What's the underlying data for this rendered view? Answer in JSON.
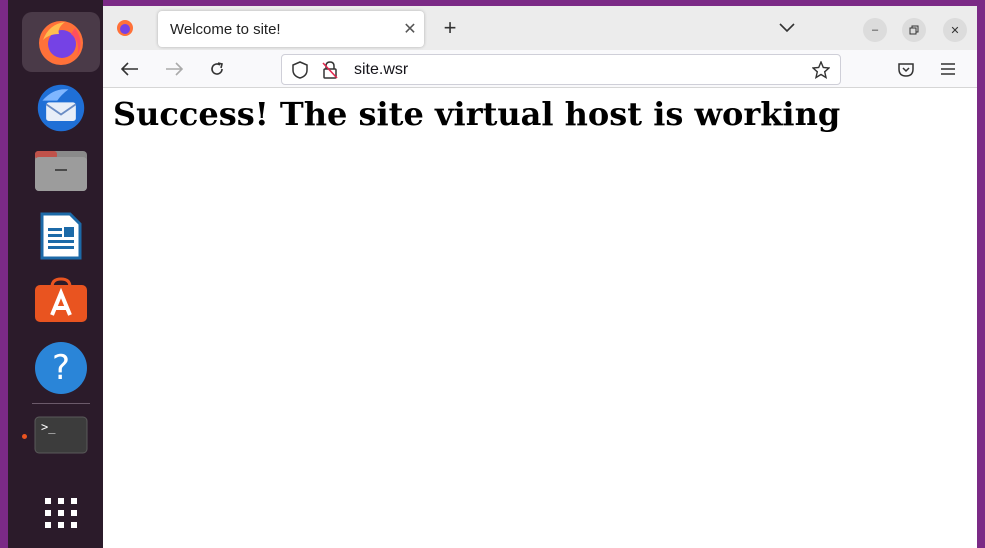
{
  "browser": {
    "tab_title": "Welcome to site!",
    "url": "site.wsr"
  },
  "page": {
    "heading": "Success! The site virtual host is working"
  },
  "dock": {
    "apps": [
      {
        "name": "Firefox",
        "icon": "firefox-icon",
        "running": true
      },
      {
        "name": "Thunderbird",
        "icon": "thunderbird-icon",
        "running": false
      },
      {
        "name": "Files",
        "icon": "files-icon",
        "running": false
      },
      {
        "name": "LibreOffice Writer",
        "icon": "writer-icon",
        "running": false
      },
      {
        "name": "Ubuntu Software",
        "icon": "software-icon",
        "running": false
      },
      {
        "name": "Help",
        "icon": "help-icon",
        "running": false
      },
      {
        "name": "Terminal",
        "icon": "terminal-icon",
        "running": true
      },
      {
        "name": "Show Applications",
        "icon": "app-grid-icon",
        "running": false
      }
    ]
  },
  "colors": {
    "desktop": "#7b2a86",
    "dock": "#2b1b2a",
    "accent": "#e95420"
  }
}
